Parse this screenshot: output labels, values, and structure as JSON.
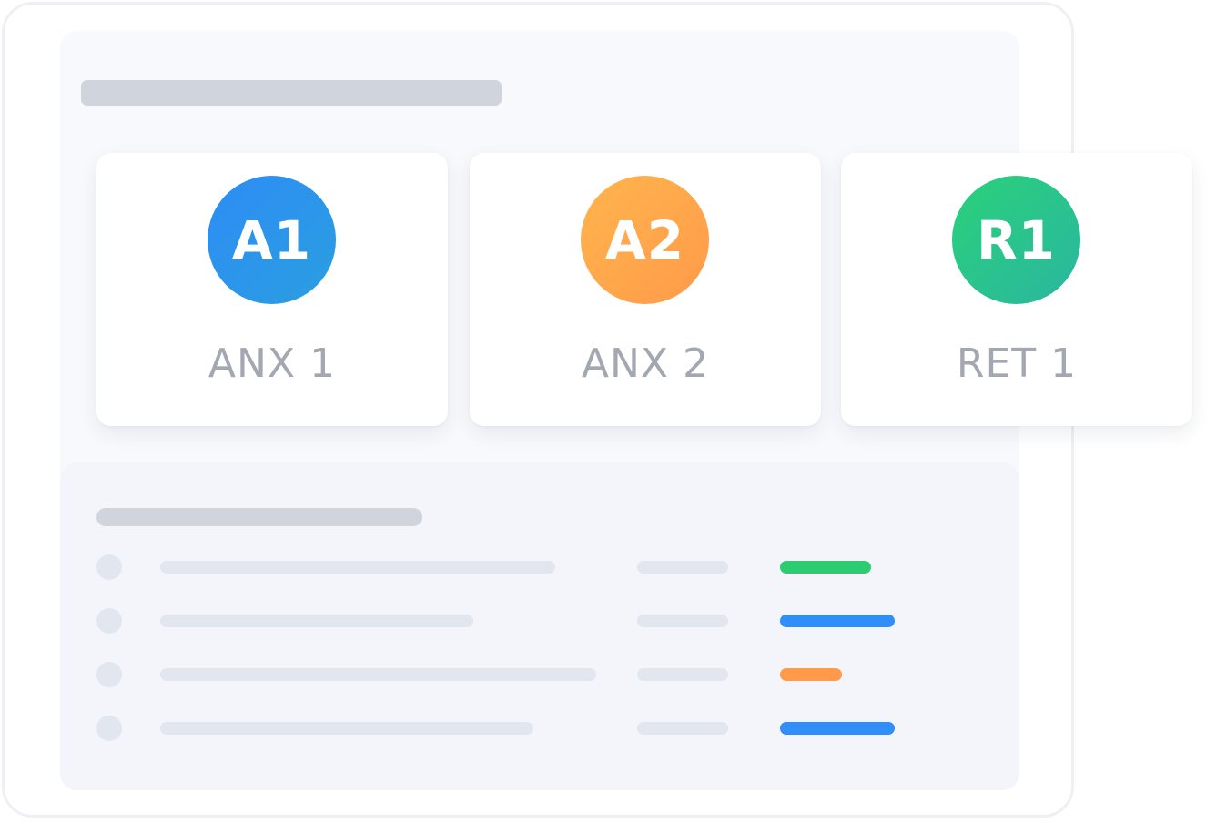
{
  "cards": [
    {
      "badge": "A1",
      "label": "ANX 1",
      "color": "#2c8df5"
    },
    {
      "badge": "A2",
      "label": "ANX 2",
      "color": "#ffa64a"
    },
    {
      "badge": "R1",
      "label": "RET 1",
      "color": "#2bc78a"
    }
  ],
  "rows": [
    {
      "status_color": "#2ecc71"
    },
    {
      "status_color": "#2f8ef7"
    },
    {
      "status_color": "#ff9a4a"
    },
    {
      "status_color": "#2f8ef7"
    }
  ]
}
